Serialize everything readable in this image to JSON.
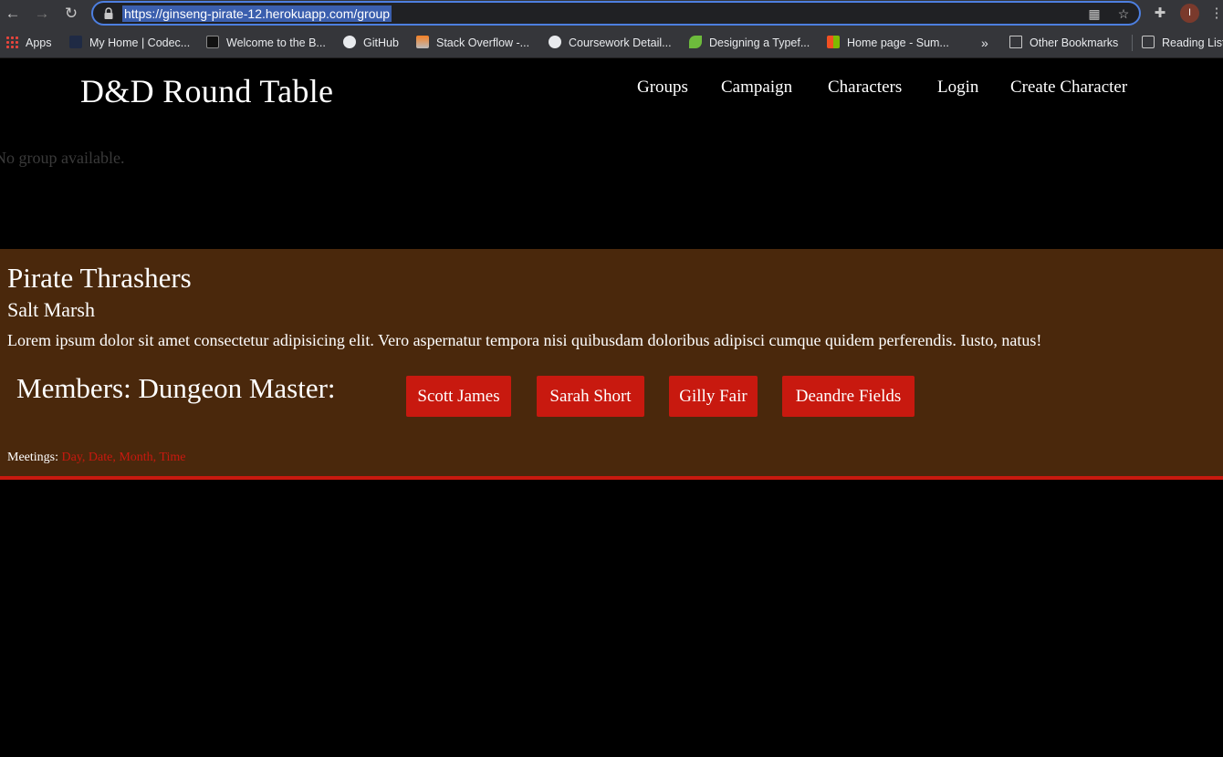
{
  "browser": {
    "url": "https://ginseng-pirate-12.herokuapp.com/group",
    "avatar_initial": "I",
    "bookmarks": [
      {
        "label": "Apps",
        "icon": "apps-grid-icon"
      },
      {
        "label": "My Home | Codec...",
        "icon": "codecademy-icon"
      },
      {
        "label": "Welcome to the B...",
        "icon": "book-icon"
      },
      {
        "label": "GitHub",
        "icon": "github-icon"
      },
      {
        "label": "Stack Overflow -...",
        "icon": "stackoverflow-icon"
      },
      {
        "label": "Coursework Detail...",
        "icon": "globe-icon"
      },
      {
        "label": "Designing a Typef...",
        "icon": "leaf-icon"
      },
      {
        "label": "Home page - Sum...",
        "icon": "microsoft-icon"
      }
    ],
    "overflow_label": "»",
    "other_bookmarks": "Other Bookmarks",
    "reading_list": "Reading List"
  },
  "site": {
    "title": "D&D Round Table",
    "nav": [
      "Groups",
      "Campaign",
      "Characters",
      "Login",
      "Create Character"
    ]
  },
  "empty_message": "No group available.",
  "group": {
    "name": "Pirate Thrashers",
    "location": "Salt Marsh",
    "description": "Lorem ipsum dolor sit amet consectetur adipisicing elit. Vero aspernatur tempora nisi quibusdam doloribus adipisci cumque quidem perferendis. Iusto, natus!",
    "members_label": "Members: Dungeon Master:",
    "members": [
      "Scott James",
      "Sarah Short",
      "Gilly Fair",
      "Deandre Fields"
    ],
    "meetings_label": "Meetings:",
    "meetings_value": "Day, Date, Month, Time"
  },
  "colors": {
    "accent": "#c8190f",
    "card_background": "#4a280c",
    "page_background": "#000000"
  }
}
